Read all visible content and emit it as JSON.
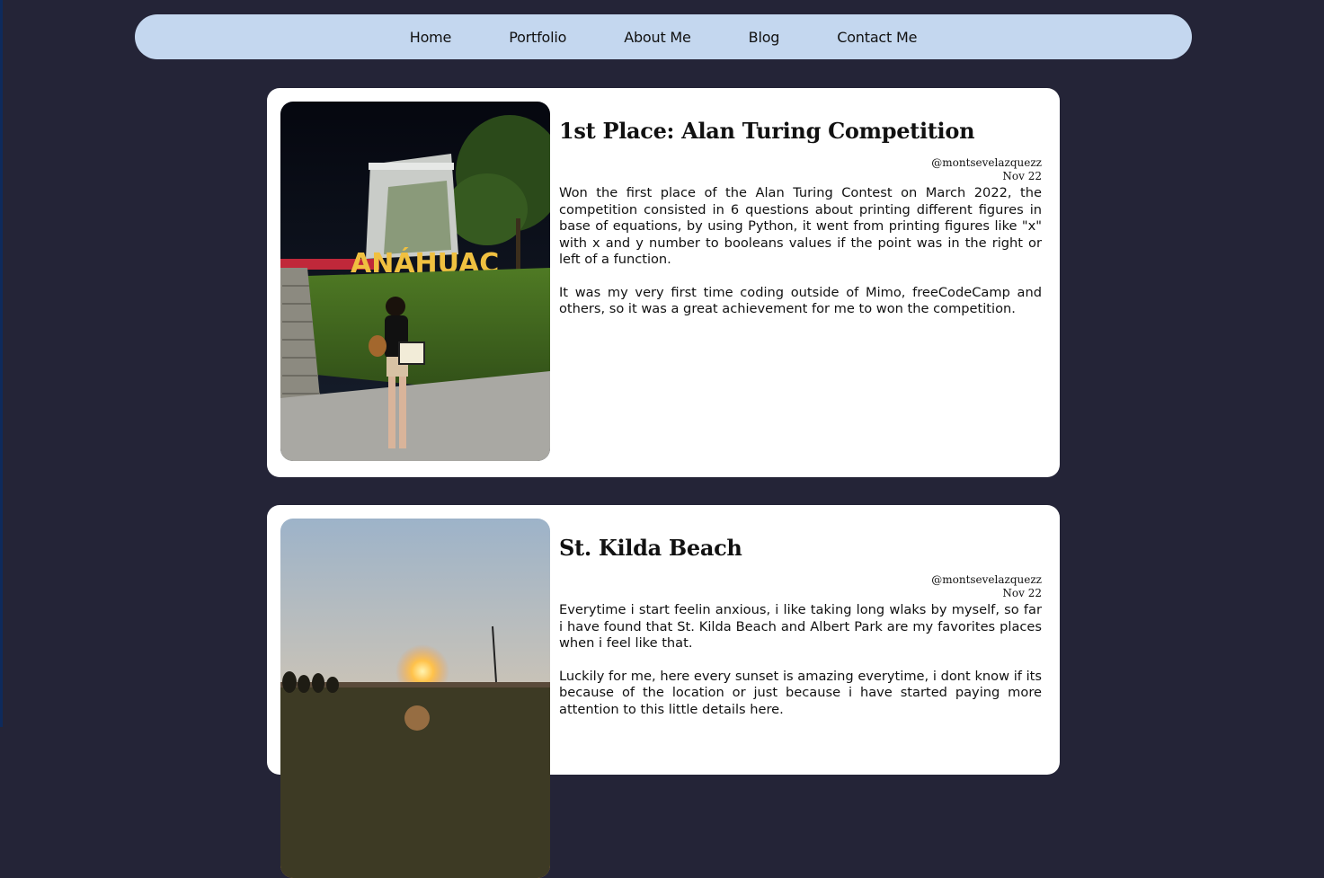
{
  "nav": {
    "items": [
      "Home",
      "Portfolio",
      "About Me",
      "Blog",
      "Contact Me"
    ]
  },
  "posts": [
    {
      "title": "1st Place: Alan Turing Competition",
      "author": "@montsevelazquezz",
      "date": "Nov 22",
      "paragraphs": [
        "Won the first place of the Alan Turing Contest on March 2022, the competition consisted in 6 questions about printing different figures in base of equations, by using Python, it went from printing figures like \"x\" with x and y number to booleans values if the point was in the right or left of a function.",
        "It was my very first time coding outside of Mimo, freeCodeCamp and others, so it was a great achievement for me to won the competition."
      ],
      "photo_sign": "ANÁHUAC"
    },
    {
      "title": "St. Kilda Beach",
      "author": "@montsevelazquezz",
      "date": "Nov 22",
      "paragraphs": [
        "Everytime i start feelin anxious, i like taking long wlaks by myself, so far i have found that St. Kilda Beach and Albert Park are my favorites places when i feel like that.",
        "Luckily for me, here every sunset is amazing everytime, i dont know if its because of the location or just because i have started paying more attention to this little details here."
      ]
    }
  ]
}
